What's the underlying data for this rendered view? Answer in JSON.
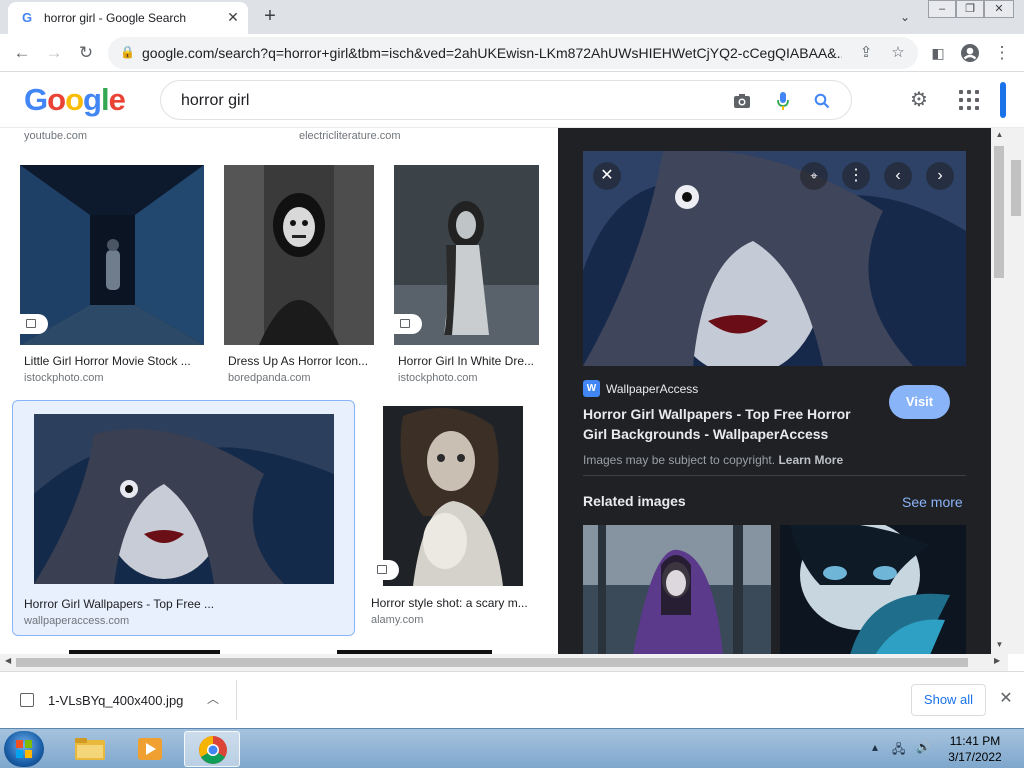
{
  "browser": {
    "tab_title": "horror girl - Google Search",
    "url": "google.com/search?q=horror+girl&tbm=isch&ved=2ahUKEwisn-LKm872AhUWsHIEHWetCjYQ2-cCegQIABAA&..."
  },
  "google": {
    "logo": [
      "G",
      "o",
      "o",
      "g",
      "l",
      "e"
    ],
    "logo_colors": [
      "#4285f4",
      "#ea4335",
      "#fbbc05",
      "#4285f4",
      "#34a853",
      "#ea4335"
    ],
    "query": "horror girl"
  },
  "results": {
    "top_sources": [
      "youtube.com",
      "electricliterature.com"
    ],
    "items": [
      {
        "title": "Little Girl Horror Movie Stock ...",
        "source": "istockphoto.com"
      },
      {
        "title": "Dress Up As Horror Icon...",
        "source": "boredpanda.com"
      },
      {
        "title": "Horror Girl In White Dre...",
        "source": "istockphoto.com"
      },
      {
        "title": "Horror Girl Wallpapers - Top Free ...",
        "source": "wallpaperaccess.com"
      },
      {
        "title": "Horror style shot: a scary m...",
        "source": "alamy.com"
      }
    ]
  },
  "panel": {
    "site_initial": "W",
    "site_name": "WallpaperAccess",
    "title": "Horror Girl Wallpapers - Top Free Horror Girl Backgrounds - WallpaperAccess",
    "visit_label": "Visit",
    "copyright_text": "Images may be subject to copyright.",
    "learn_more": "Learn More",
    "related_label": "Related images",
    "see_more": "See more"
  },
  "downloads": {
    "file_name": "1-VLsBYq_400x400.jpg",
    "show_all": "Show all"
  },
  "taskbar": {
    "time": "11:41 PM",
    "date": "3/17/2022"
  },
  "colors": {
    "link_blue": "#1a73e8",
    "panel_bg": "#202124",
    "visit_blue": "#8ab4f8",
    "selected_bg": "#e8f0fe"
  }
}
